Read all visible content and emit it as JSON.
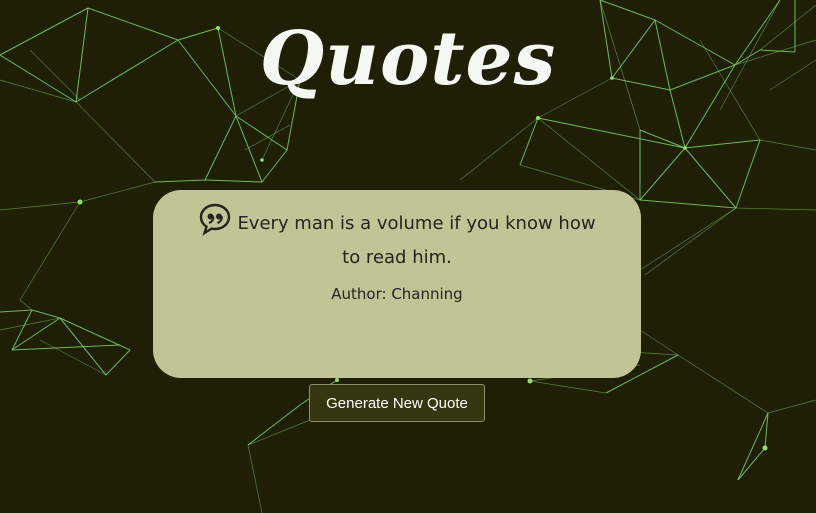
{
  "header": {
    "title": "Quotes"
  },
  "quote": {
    "icon": "quote-icon",
    "text": "Every man is a volume if you know how to read him.",
    "author_label": "Author: Channing"
  },
  "actions": {
    "generate_label": "Generate New Quote"
  },
  "colors": {
    "background": "#1f1f05",
    "network_lines": "#7fd35e",
    "card": "#c3c496",
    "button": "#363611",
    "title": "#f5f8f2"
  }
}
